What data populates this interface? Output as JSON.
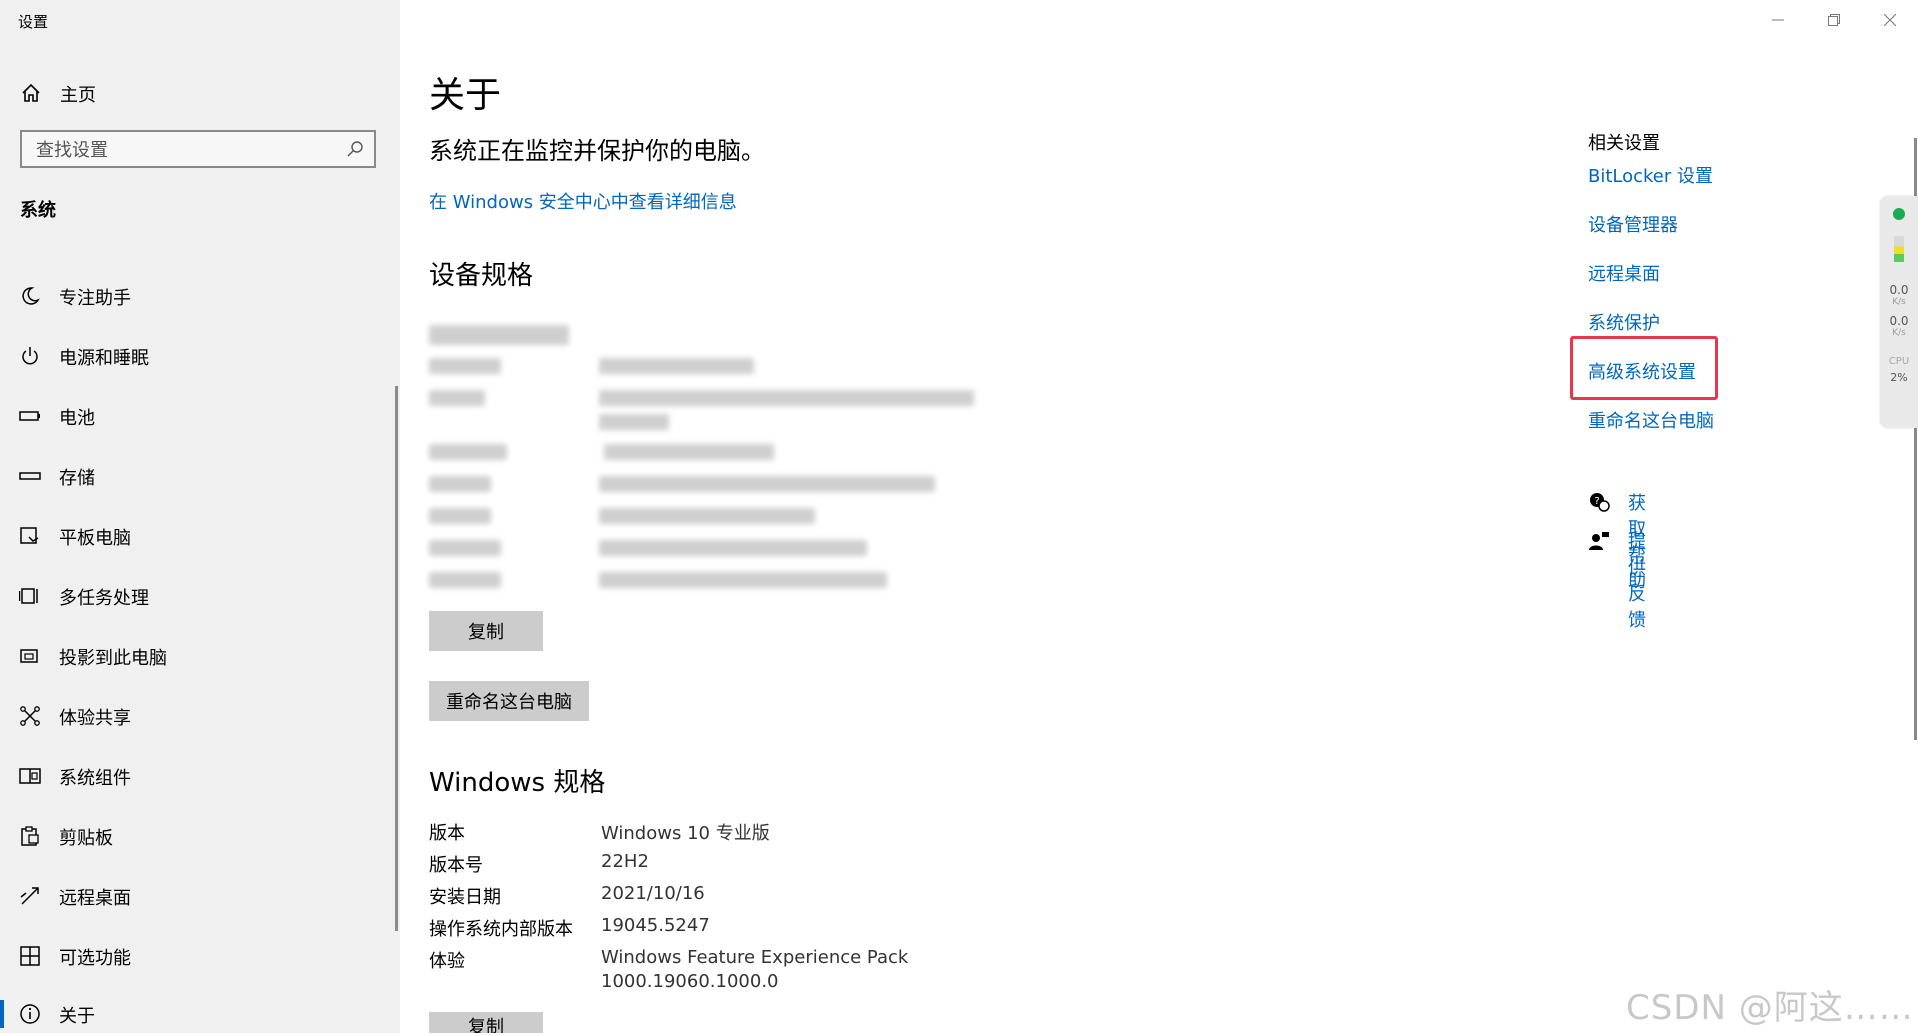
{
  "app": {
    "title": "设置"
  },
  "sidebar": {
    "home_label": "主页",
    "search_placeholder": "查找设置",
    "section_title": "系统",
    "items": [
      {
        "label": "专注助手",
        "icon": "moon-icon"
      },
      {
        "label": "电源和睡眠",
        "icon": "power-icon"
      },
      {
        "label": "电池",
        "icon": "battery-icon"
      },
      {
        "label": "存储",
        "icon": "storage-icon"
      },
      {
        "label": "平板电脑",
        "icon": "tablet-icon"
      },
      {
        "label": "多任务处理",
        "icon": "multitask-icon"
      },
      {
        "label": "投影到此电脑",
        "icon": "project-icon"
      },
      {
        "label": "体验共享",
        "icon": "share-icon"
      },
      {
        "label": "系统组件",
        "icon": "components-icon"
      },
      {
        "label": "剪贴板",
        "icon": "clipboard-icon"
      },
      {
        "label": "远程桌面",
        "icon": "remote-icon"
      },
      {
        "label": "可选功能",
        "icon": "grid-icon"
      },
      {
        "label": "关于",
        "icon": "info-icon",
        "active": true
      }
    ]
  },
  "main": {
    "title": "关于",
    "protect_text": "系统正在监控并保护你的电脑。",
    "security_link": "在 Windows 安全中心中查看详细信息",
    "device_specs_title": "设备规格",
    "copy_button": "复制",
    "rename_button": "重命名这台电脑",
    "windows_specs_title": "Windows 规格",
    "windows_specs": [
      {
        "label": "版本",
        "value": "Windows 10 专业版"
      },
      {
        "label": "版本号",
        "value": "22H2"
      },
      {
        "label": "安装日期",
        "value": "2021/10/16"
      },
      {
        "label": "操作系统内部版本",
        "value": "19045.5247"
      },
      {
        "label": "体验",
        "value": "Windows Feature Experience Pack",
        "value2": "1000.19060.1000.0"
      }
    ],
    "copy_button_2": "复制"
  },
  "related": {
    "title": "相关设置",
    "links": [
      "BitLocker 设置",
      "设备管理器",
      "远程桌面",
      "系统保护",
      "高级系统设置",
      "重命名这台电脑"
    ],
    "highlighted_index": 4,
    "help_label": "获取帮助",
    "feedback_label": "提供反馈"
  },
  "widget": {
    "up": "0.0",
    "down": "0.0",
    "unit": "K/s",
    "cpu_label": "CPU",
    "cpu_value": "2%"
  },
  "watermark": "CSDN @阿这……",
  "colors": {
    "accent": "#0067c0",
    "highlight": "#e8364f",
    "sidebar_bg": "#f0f0f0"
  }
}
